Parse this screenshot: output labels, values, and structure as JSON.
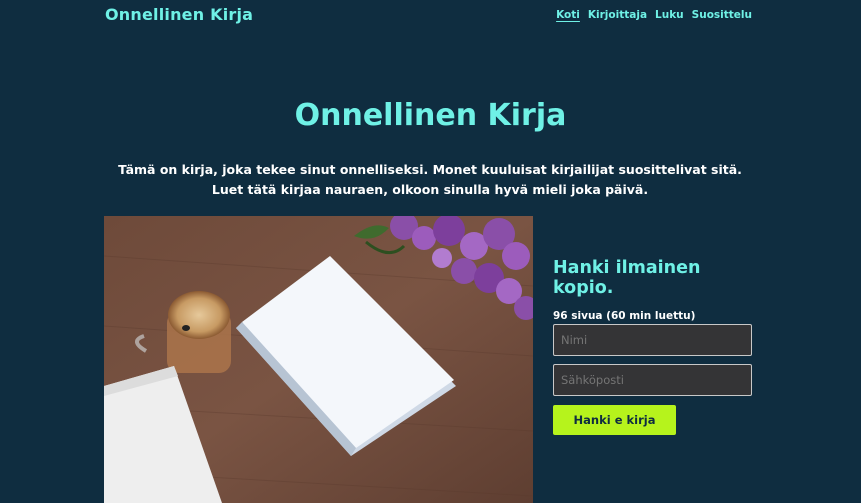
{
  "header": {
    "brand": "Onnellinen Kirja",
    "nav": [
      "Koti",
      "Kirjoittaja",
      "Luku",
      "Suosittelu"
    ]
  },
  "hero": {
    "title": "Onnellinen Kirja",
    "intro": "Tämä on kirja, joka tekee sinut onnelliseksi. Monet kuuluisat kirjailijat suosittelivat sitä. Luet tätä kirjaa nauraen, olkoon sinulla hyvä mieli joka päivä."
  },
  "signup": {
    "title": "Hanki ilmainen kopio.",
    "subtitle": "96 sivua (60 min luettu)",
    "name_placeholder": "Nimi",
    "email_placeholder": "Sähköposti",
    "button": "Hanki e kirja"
  },
  "colors": {
    "background": "#0f2d40",
    "accent": "#6ff1e6",
    "button": "#b6f31c"
  }
}
